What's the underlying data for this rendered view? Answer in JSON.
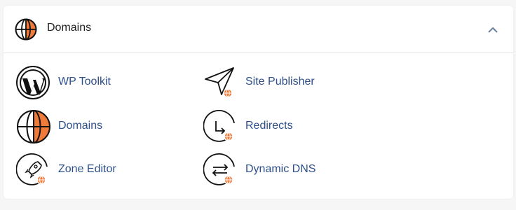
{
  "section": {
    "title": "Domains",
    "icon": "globe-icon",
    "collapse_icon": "chevron-up-icon"
  },
  "items": [
    {
      "label": "WP Toolkit",
      "icon": "wordpress-icon"
    },
    {
      "label": "Site Publisher",
      "icon": "paper-plane-icon"
    },
    {
      "label": "Domains",
      "icon": "globe-icon"
    },
    {
      "label": "Redirects",
      "icon": "redirect-arrow-icon"
    },
    {
      "label": "Zone Editor",
      "icon": "rocket-icon"
    },
    {
      "label": "Dynamic DNS",
      "icon": "swap-arrows-icon"
    }
  ],
  "colors": {
    "accent": "#ef7a3a",
    "link": "#2d4f8b",
    "icon_stroke": "#111111"
  }
}
